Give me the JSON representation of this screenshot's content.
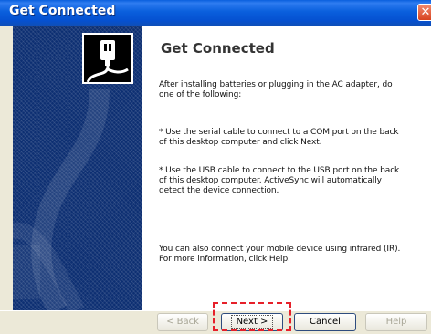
{
  "window": {
    "title": "Get Connected",
    "close_glyph": "✕",
    "icon": "usb-cable-icon"
  },
  "content": {
    "heading": "Get Connected",
    "paragraphs": [
      "After installing batteries or plugging in the AC adapter, do one of the following:",
      "* Use the serial cable to connect to a COM port on the back of this desktop computer and click Next.",
      "* Use the USB cable to connect to the USB port on the back of this desktop computer.  ActiveSync will automatically detect the device connection.",
      "You can also connect your mobile device using infrared (IR). For more information, click Help."
    ]
  },
  "buttons": {
    "back": "< Back",
    "next": "Next >",
    "cancel": "Cancel",
    "help": "Help"
  },
  "colors": {
    "titlebar": "#0a5fdd",
    "panel": "#0d2f72",
    "highlight": "#e6202a"
  }
}
